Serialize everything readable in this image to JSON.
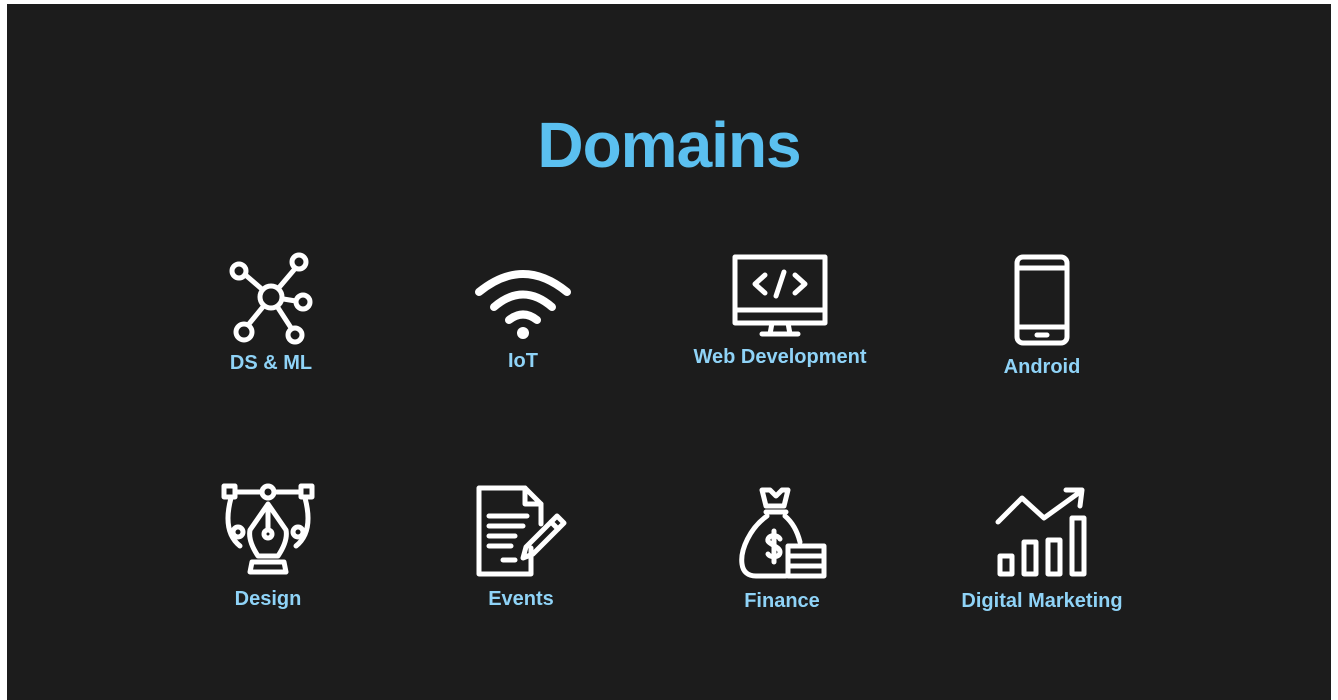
{
  "page": {
    "title": "Domains",
    "colors": {
      "background": "#1c1c1c",
      "title": "#5bc0f0",
      "label": "#8fd3f7",
      "icon": "#ffffff"
    }
  },
  "domains": [
    {
      "label": "DS & ML",
      "icon": "network-icon"
    },
    {
      "label": "IoT",
      "icon": "wifi-icon"
    },
    {
      "label": "Web Development",
      "icon": "code-monitor-icon"
    },
    {
      "label": "Android",
      "icon": "smartphone-icon"
    },
    {
      "label": "Design",
      "icon": "pen-tool-icon"
    },
    {
      "label": "Events",
      "icon": "document-pen-icon"
    },
    {
      "label": "Finance",
      "icon": "money-bag-icon"
    },
    {
      "label": "Digital Marketing",
      "icon": "growth-chart-icon"
    }
  ]
}
